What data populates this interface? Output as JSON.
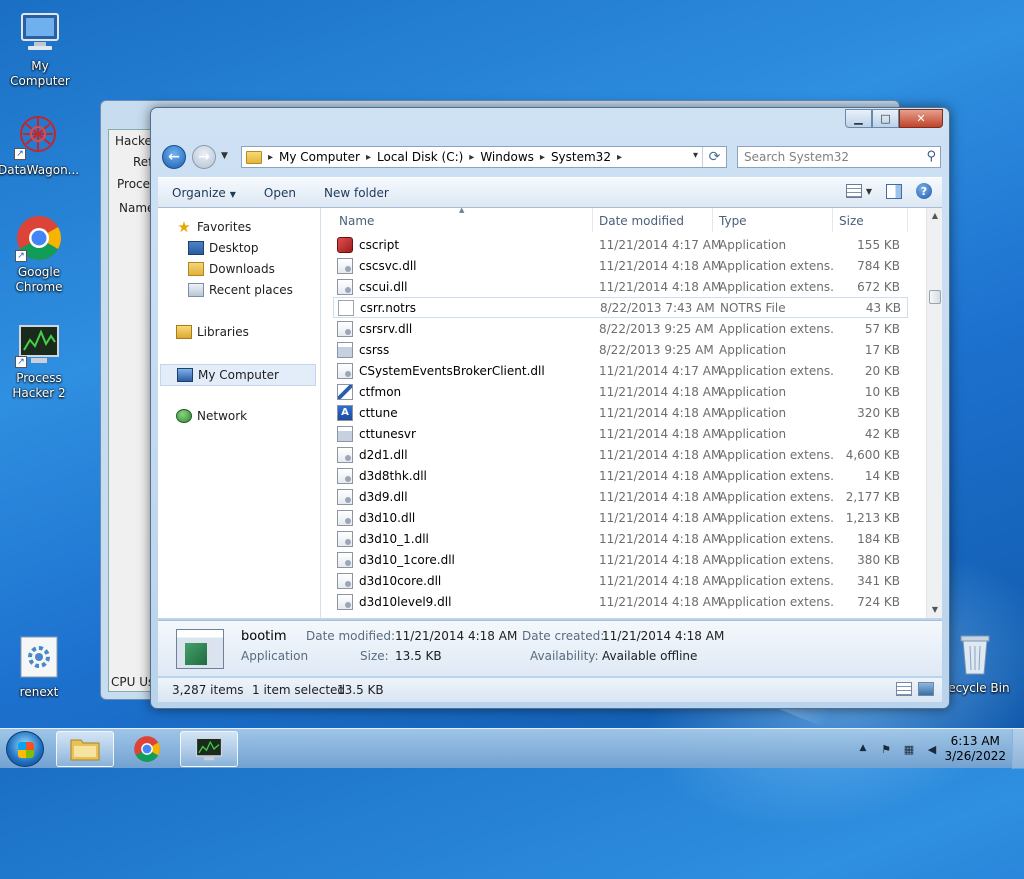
{
  "desktop": {
    "icons": [
      {
        "label": "My Computer",
        "icon": "computer-icon"
      },
      {
        "label": "DataWagon...",
        "icon": "network-app-icon"
      },
      {
        "label": "Google Chrome",
        "icon": "chrome-icon"
      },
      {
        "label": "Process Hacker 2",
        "icon": "process-hacker-icon"
      },
      {
        "label": "renext",
        "icon": "gear-file-icon"
      },
      {
        "label": "Recycle Bin",
        "icon": "recycle-bin-icon"
      }
    ]
  },
  "background_window": {
    "menu_label": "Hacker",
    "refresh_label": "Ref",
    "tab_label": "Process",
    "column_label": "Name",
    "cpu_label": "CPU Us"
  },
  "explorer": {
    "address": {
      "crumbs": [
        "My Computer",
        "Local Disk (C:)",
        "Windows",
        "System32"
      ]
    },
    "search_placeholder": "Search System32",
    "toolbar": {
      "organize": "Organize",
      "open": "Open",
      "new_folder": "New folder"
    },
    "nav": {
      "favorites": "Favorites",
      "desktop": "Desktop",
      "downloads": "Downloads",
      "recent": "Recent places",
      "libraries": "Libraries",
      "my_computer": "My Computer",
      "network": "Network"
    },
    "columns": {
      "name": "Name",
      "date": "Date modified",
      "type": "Type",
      "size": "Size"
    },
    "files": [
      {
        "name": "cscript",
        "date": "11/21/2014 4:17 AM",
        "type": "Application",
        "size": "155 KB",
        "icon": "red"
      },
      {
        "name": "cscsvc.dll",
        "date": "11/21/2014 4:18 AM",
        "type": "Application extens...",
        "size": "784 KB",
        "icon": "dll"
      },
      {
        "name": "cscui.dll",
        "date": "11/21/2014 4:18 AM",
        "type": "Application extens...",
        "size": "672 KB",
        "icon": "dll"
      },
      {
        "name": "csrr.notrs",
        "date": "8/22/2013 7:43 AM",
        "type": "NOTRS File",
        "size": "43 KB",
        "icon": "blank"
      },
      {
        "name": "csrsrv.dll",
        "date": "8/22/2013 9:25 AM",
        "type": "Application extens...",
        "size": "57 KB",
        "icon": "dll"
      },
      {
        "name": "csrss",
        "date": "8/22/2013 9:25 AM",
        "type": "Application",
        "size": "17 KB",
        "icon": "app"
      },
      {
        "name": "CSystemEventsBrokerClient.dll",
        "date": "11/21/2014 4:17 AM",
        "type": "Application extens...",
        "size": "20 KB",
        "icon": "dll"
      },
      {
        "name": "ctfmon",
        "date": "11/21/2014 4:18 AM",
        "type": "Application",
        "size": "10 KB",
        "icon": "pen"
      },
      {
        "name": "cttune",
        "date": "11/21/2014 4:18 AM",
        "type": "Application",
        "size": "320 KB",
        "icon": "tune"
      },
      {
        "name": "cttunesvr",
        "date": "11/21/2014 4:18 AM",
        "type": "Application",
        "size": "42 KB",
        "icon": "app"
      },
      {
        "name": "d2d1.dll",
        "date": "11/21/2014 4:18 AM",
        "type": "Application extens...",
        "size": "4,600 KB",
        "icon": "dll"
      },
      {
        "name": "d3d8thk.dll",
        "date": "11/21/2014 4:18 AM",
        "type": "Application extens...",
        "size": "14 KB",
        "icon": "dll"
      },
      {
        "name": "d3d9.dll",
        "date": "11/21/2014 4:18 AM",
        "type": "Application extens...",
        "size": "2,177 KB",
        "icon": "dll"
      },
      {
        "name": "d3d10.dll",
        "date": "11/21/2014 4:18 AM",
        "type": "Application extens...",
        "size": "1,213 KB",
        "icon": "dll"
      },
      {
        "name": "d3d10_1.dll",
        "date": "11/21/2014 4:18 AM",
        "type": "Application extens...",
        "size": "184 KB",
        "icon": "dll"
      },
      {
        "name": "d3d10_1core.dll",
        "date": "11/21/2014 4:18 AM",
        "type": "Application extens...",
        "size": "380 KB",
        "icon": "dll"
      },
      {
        "name": "d3d10core.dll",
        "date": "11/21/2014 4:18 AM",
        "type": "Application extens...",
        "size": "341 KB",
        "icon": "dll"
      },
      {
        "name": "d3d10level9.dll",
        "date": "11/21/2014 4:18 AM",
        "type": "Application extens...",
        "size": "724 KB",
        "icon": "dll"
      }
    ],
    "details": {
      "name": "bootim",
      "type": "Application",
      "date_modified_label": "Date modified:",
      "date_modified": "11/21/2014 4:18 AM",
      "size_label": "Size:",
      "size": "13.5 KB",
      "date_created_label": "Date created:",
      "date_created": "11/21/2014 4:18 AM",
      "availability_label": "Availability:",
      "availability": "Available offline"
    },
    "status": {
      "count": "3,287 items",
      "selected": "1 item selected",
      "selected_size": "13.5 KB"
    }
  },
  "taskbar": {
    "time": "6:13 AM",
    "date": "3/26/2022"
  },
  "colors": {
    "desktop_blue": "#1d72cf",
    "window_frame": "#b9d3ec",
    "close_red": "#c0432a",
    "selection": "#e2edf9"
  }
}
